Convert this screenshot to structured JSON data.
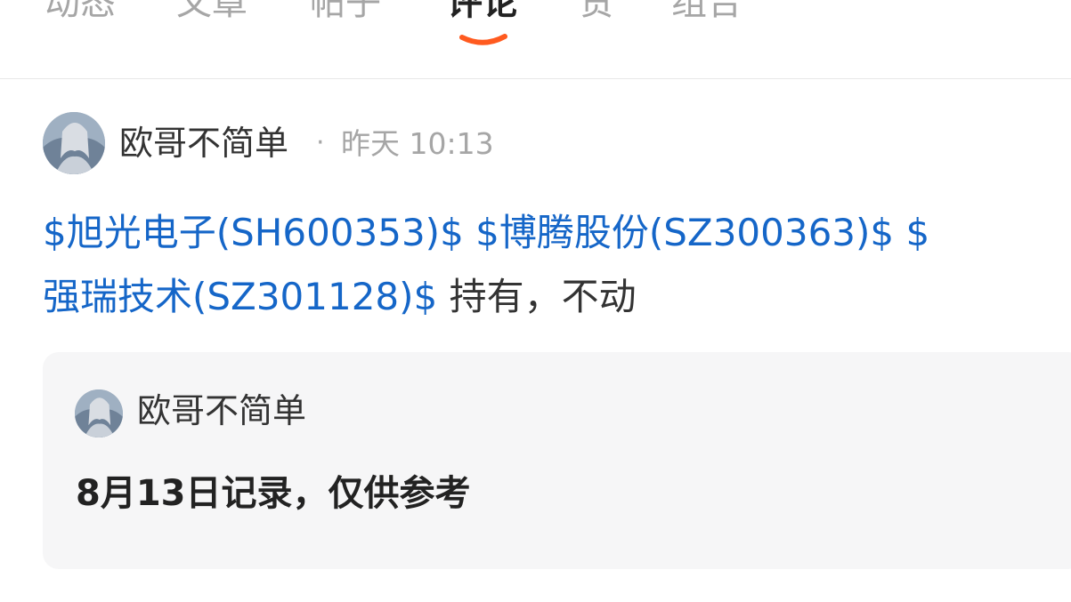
{
  "tabs": [
    {
      "label": "动态"
    },
    {
      "label": "文章"
    },
    {
      "label": "帖子"
    },
    {
      "label": "评论",
      "active": true
    },
    {
      "label": "赞"
    },
    {
      "label": "组合"
    }
  ],
  "accent_color": "#ff5a1f",
  "link_color": "#1566c8",
  "post": {
    "author": "欧哥不简单",
    "separator": "·",
    "time": "昨天 10:13",
    "avatar_icon": "avatar-anime-character",
    "line1_links": [
      "$旭光电子(SH600353)$",
      "$博腾股份(SZ300363)$",
      "$"
    ],
    "line2_link": "强瑞技术(SZ301128)$",
    "line2_text": "持有，不动"
  },
  "quote": {
    "author": "欧哥不简单",
    "text": "8月13日记录，仅供参考"
  }
}
